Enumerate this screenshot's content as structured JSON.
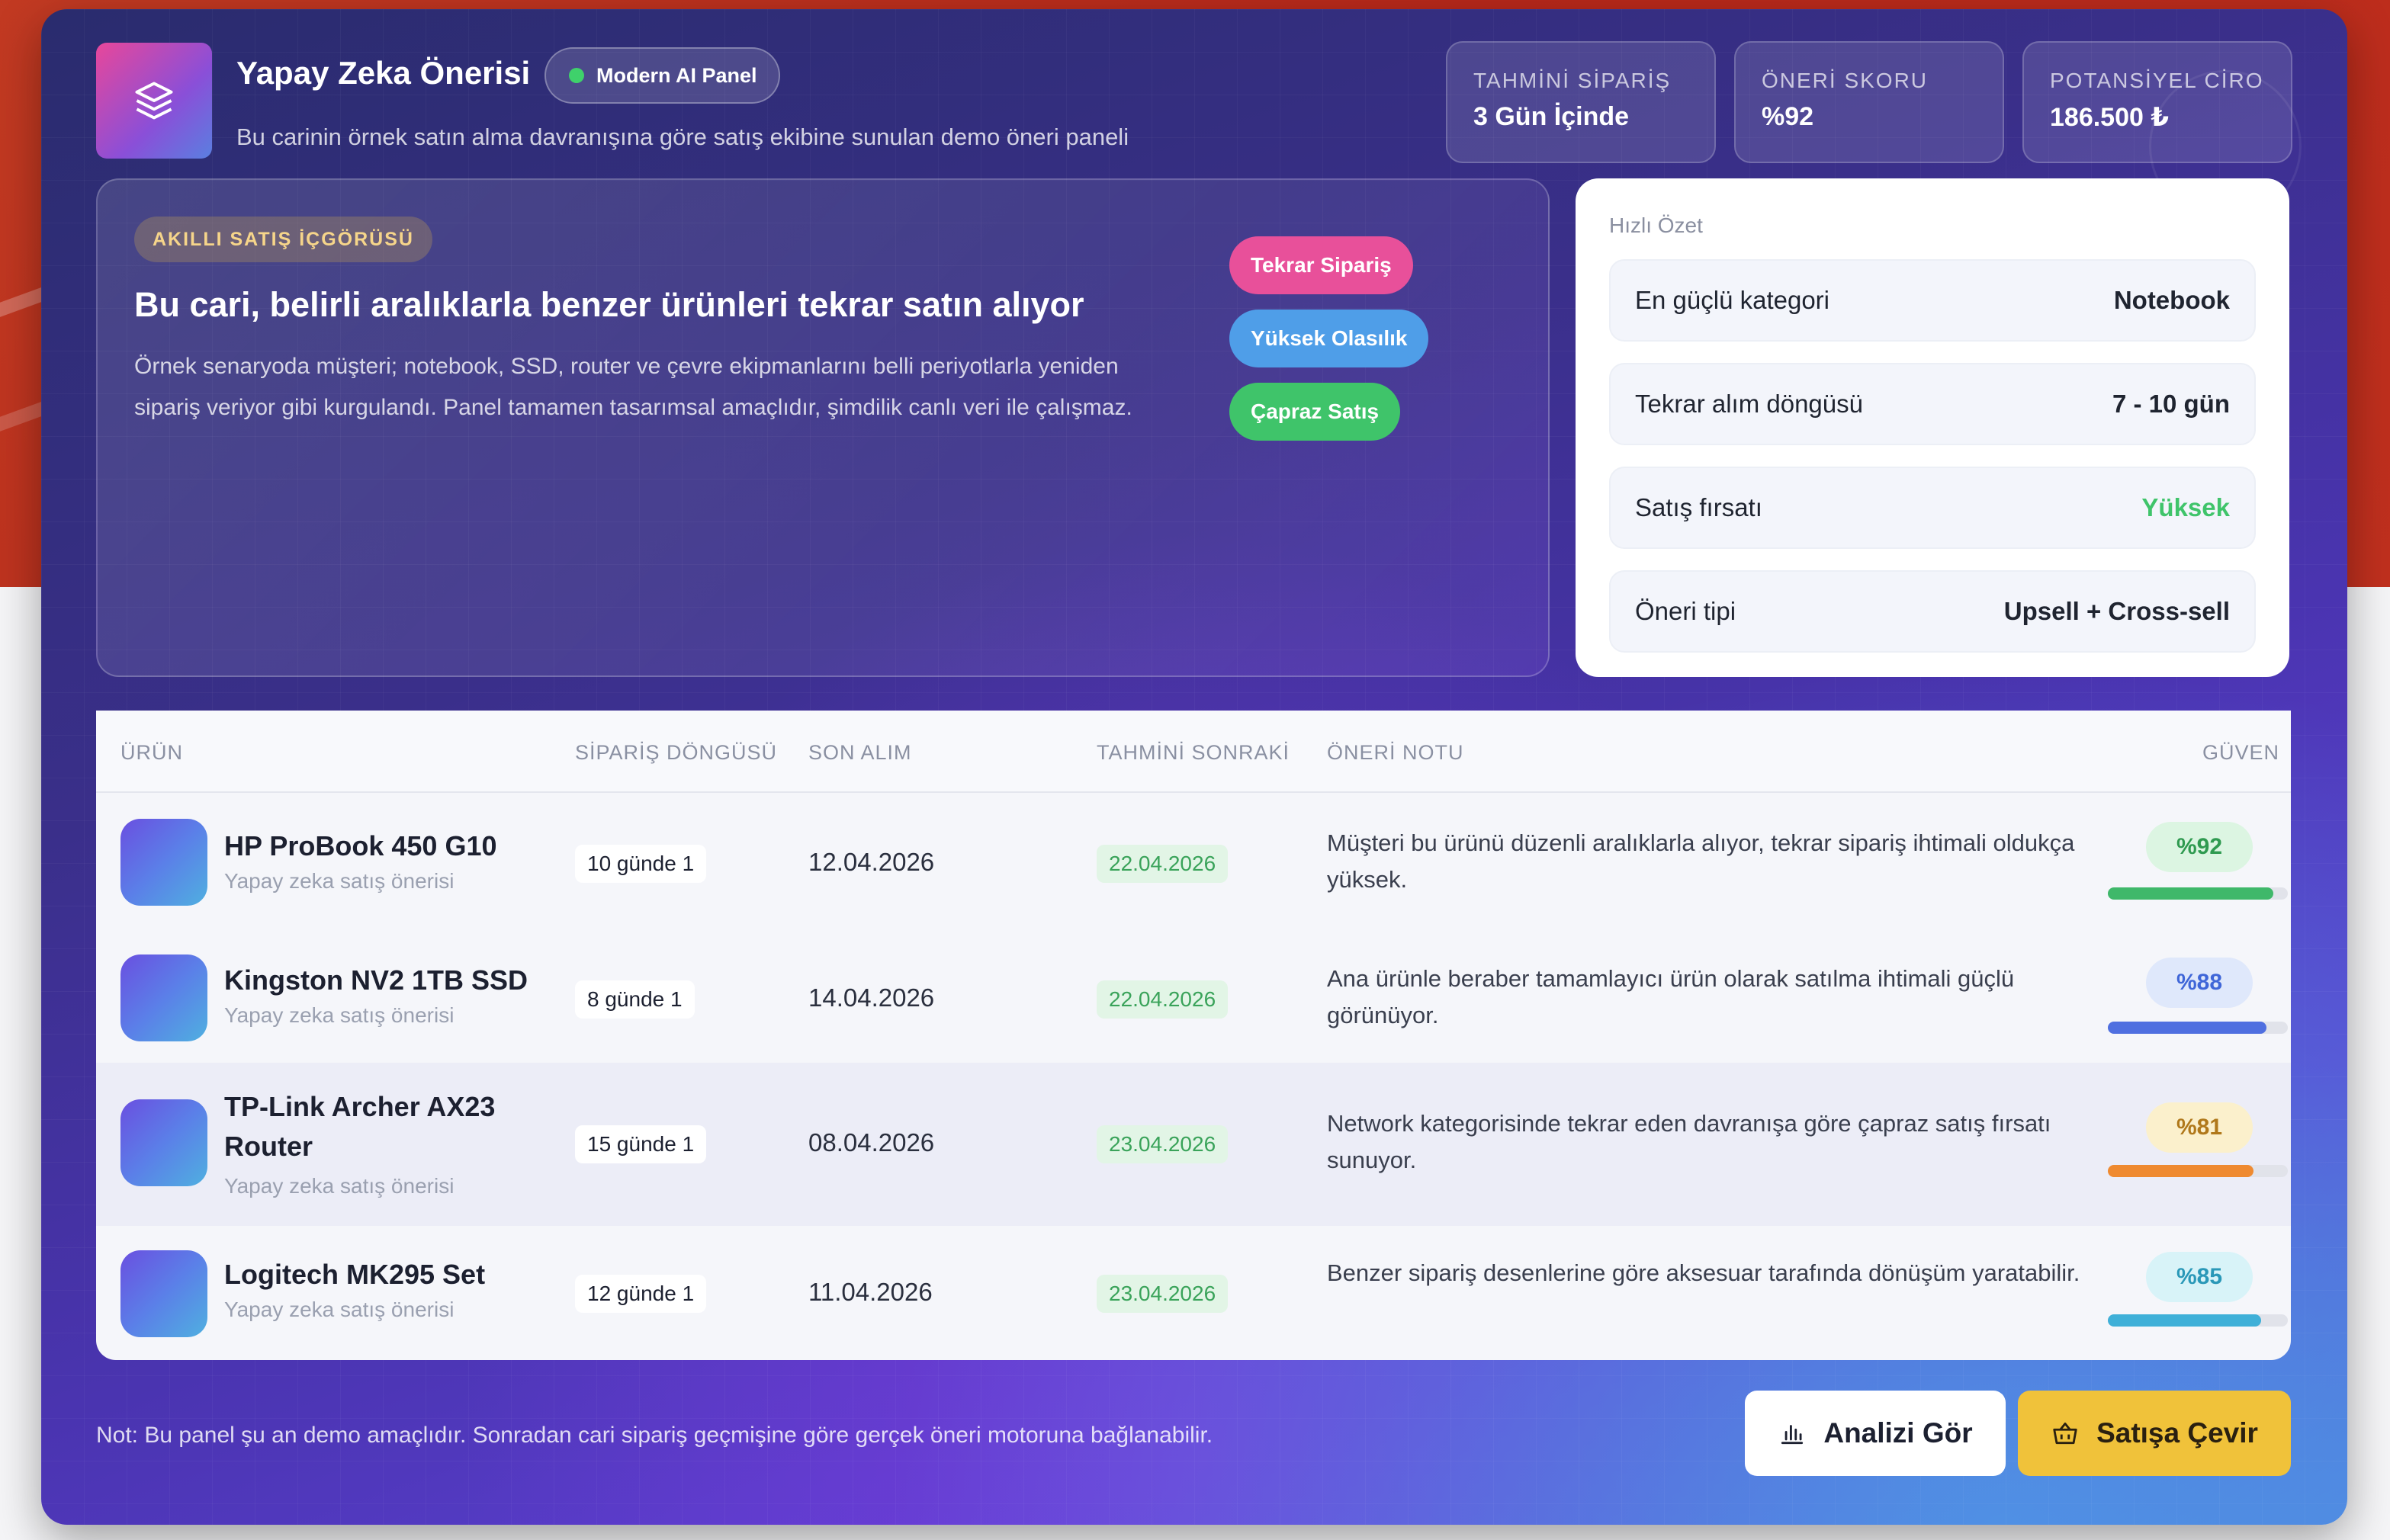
{
  "header": {
    "title": "Yapay Zeka Önerisi",
    "badge": "Modern AI Panel",
    "subtitle": "Bu carinin örnek satın alma davranışına göre satış ekibine sunulan demo öneri paneli",
    "logo_icon": "layers-icon"
  },
  "stats": [
    {
      "label": "TAHMİNİ SİPARİŞ",
      "value": "3 Gün İçinde"
    },
    {
      "label": "ÖNERİ SKORU",
      "value": "%92"
    },
    {
      "label": "POTANSİYEL CİRO",
      "value": "186.500 ₺"
    }
  ],
  "insight": {
    "chip": "AKILLI SATIŞ İÇGÖRÜSÜ",
    "title": "Bu cari, belirli aralıklarla benzer ürünleri tekrar satın alıyor",
    "description": "Örnek senaryoda müşteri; notebook, SSD, router ve çevre ekipmanlarını belli periyotlarla yeniden sipariş veriyor gibi kurgulandı. Panel tamamen tasarımsal amaçlıdır, şimdilik canlı veri ile çalışmaz.",
    "pills": [
      {
        "label": "Tekrar Sipariş",
        "color": "#e8509a"
      },
      {
        "label": "Yüksek Olasılık",
        "color": "#4f9ee8"
      },
      {
        "label": "Çapraz Satış",
        "color": "#3fc46a"
      }
    ]
  },
  "summary": {
    "label": "Hızlı Özet",
    "rows": [
      {
        "key": "En güçlü kategori",
        "value": "Notebook",
        "color": "#1f2430"
      },
      {
        "key": "Tekrar alım döngüsü",
        "value": "7 - 10 gün",
        "color": "#1f2430"
      },
      {
        "key": "Satış fırsatı",
        "value": "Yüksek",
        "color": "#3fc46a"
      },
      {
        "key": "Öneri tipi",
        "value": "Upsell + Cross-sell",
        "color": "#1f2430"
      }
    ]
  },
  "table": {
    "headers": [
      "ÜRÜN",
      "SİPARİŞ DÖNGÜSÜ",
      "SON ALIM",
      "TAHMİNİ SONRAKİ",
      "ÖNERİ NOTU",
      "GÜVEN"
    ],
    "rows": [
      {
        "name": "HP ProBook 450 G10",
        "sub": "Yapay zeka satış önerisi",
        "cycle": "10 günde 1",
        "last": "12.04.2026",
        "next": "22.04.2026",
        "note": "Müşteri bu ürünü düzenli aralıklarla alıyor, tekrar sipariş ihtimali oldukça yüksek.",
        "confidence": "%92",
        "confidence_value": 92,
        "badge_bg": "#dcf5e2",
        "badge_fg": "#2f9a50",
        "bar_color": "#3fb86a"
      },
      {
        "name": "Kingston NV2 1TB SSD",
        "sub": "Yapay zeka satış önerisi",
        "cycle": "8 günde 1",
        "last": "14.04.2026",
        "next": "22.04.2026",
        "note": "Ana ürünle beraber tamamlayıcı ürün olarak satılma ihtimali güçlü görünüyor.",
        "confidence": "%88",
        "confidence_value": 88,
        "badge_bg": "#dfe8fb",
        "badge_fg": "#3f66d8",
        "bar_color": "#4f6fe0"
      },
      {
        "name": "TP-Link Archer AX23 Router",
        "sub": "Yapay zeka satış önerisi",
        "cycle": "15 günde 1",
        "last": "08.04.2026",
        "next": "23.04.2026",
        "note": "Network kategorisinde tekrar eden davranışa göre çapraz satış fırsatı sunuyor.",
        "confidence": "%81",
        "confidence_value": 81,
        "badge_bg": "#fbf0cc",
        "badge_fg": "#b0781a",
        "bar_color": "#ef8a30"
      },
      {
        "name": "Logitech MK295 Set",
        "sub": "Yapay zeka satış önerisi",
        "cycle": "12 günde 1",
        "last": "11.04.2026",
        "next": "23.04.2026",
        "note": "Benzer sipariş desenlerine göre aksesuar tarafında dönüşüm yaratabilir.",
        "confidence": "%85",
        "confidence_value": 85,
        "badge_bg": "#d8f3f8",
        "badge_fg": "#2a98b8",
        "bar_color": "#3fb0d8"
      }
    ]
  },
  "footer": {
    "note": "Not: Bu panel şu an demo amaçlıdır. Sonradan cari sipariş geçmişine göre gerçek öneri motoruna bağlanabilir.",
    "analyze_label": "Analizi Gör",
    "analyze_icon": "bar-chart-icon",
    "sell_label": "Satışa Çevir",
    "sell_icon": "basket-icon"
  }
}
